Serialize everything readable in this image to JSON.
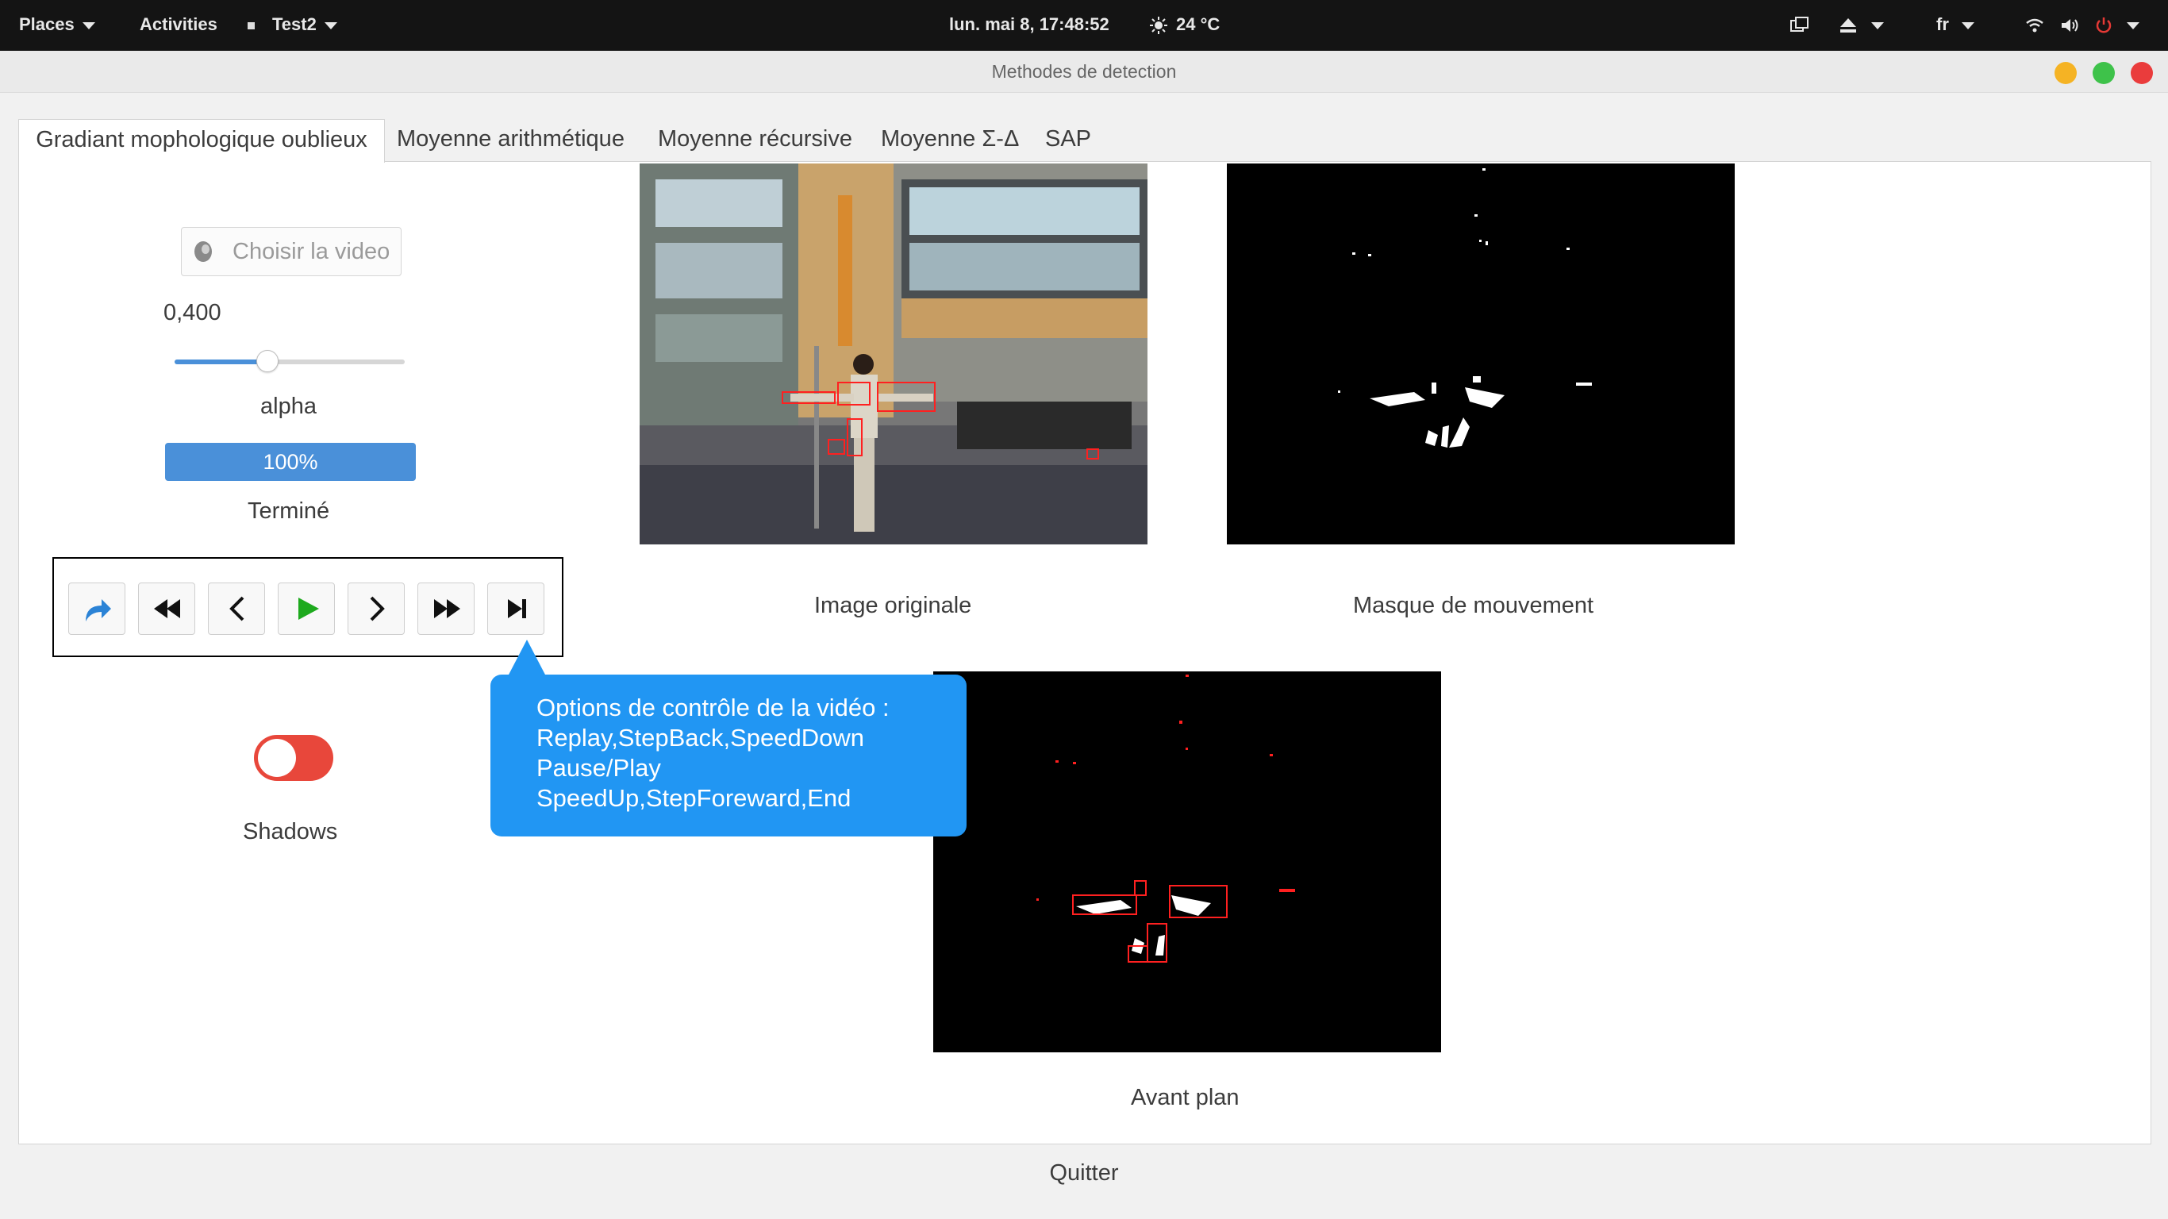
{
  "topbar": {
    "places": "Places",
    "activities": "Activities",
    "app": "Test2",
    "datetime": "lun. mai  8, 17:48:52",
    "weather": "24 °C",
    "lang": "fr"
  },
  "window": {
    "title": "Methodes de detection",
    "colors": {
      "minimize": "#f5b324",
      "maximize": "#3ec24a",
      "close": "#ea3c3c"
    }
  },
  "tabs": [
    {
      "label": "Gradiant mophologique oublieux",
      "active": true
    },
    {
      "label": "Moyenne arithmétique"
    },
    {
      "label": "Moyenne récursive"
    },
    {
      "label": "Moyenne Σ-Δ"
    },
    {
      "label": "SAP"
    }
  ],
  "controls": {
    "choose_video": "Choisir la video",
    "alpha_value": "0,400",
    "alpha_fraction": 0.4,
    "alpha_label": "alpha",
    "progress_text": "100%",
    "progress_value": 1.0,
    "status": "Terminé",
    "shadows_label": "Shadows",
    "shadows_on": true
  },
  "playback_icons": [
    "replay-icon",
    "speed-down-icon",
    "step-back-icon",
    "play-icon",
    "step-forward-icon",
    "speed-up-icon",
    "end-icon"
  ],
  "images": {
    "original": "Image originale",
    "mask": "Masque de mouvement",
    "foreground": "Avant plan"
  },
  "tooltip": {
    "line1": "Options de contrôle de la vidéo :",
    "line2": "Replay,StepBack,SpeedDown",
    "line3": "Pause/Play",
    "line4": "SpeedUp,StepForeward,End"
  },
  "quit": "Quitter"
}
